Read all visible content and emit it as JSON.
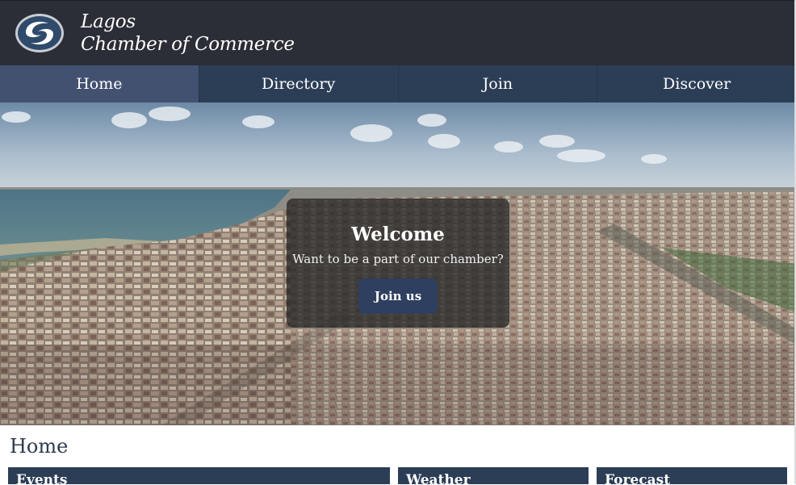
{
  "header": {
    "brand_line1": "Lagos",
    "brand_line2": "Chamber of Commerce",
    "logo_icon": "swirl-logo-icon"
  },
  "nav": {
    "items": [
      {
        "label": "Home",
        "active": true
      },
      {
        "label": "Directory",
        "active": false
      },
      {
        "label": "Join",
        "active": false
      },
      {
        "label": "Discover",
        "active": false
      }
    ]
  },
  "hero": {
    "image": "aerial-city-photo",
    "welcome_title": "Welcome",
    "welcome_subtitle": "Want to be a part of our chamber?",
    "cta_label": "Join us"
  },
  "main": {
    "page_title": "Home",
    "cards": [
      {
        "title": "Events"
      },
      {
        "title": "Weather"
      },
      {
        "title": "Forecast"
      }
    ]
  },
  "colors": {
    "header_bg": "#2b2e36",
    "nav_bg": "#2c3e56",
    "nav_active_bg": "#435171",
    "card_bg": "#2c3e56",
    "button_bg": "#2e3f5f"
  }
}
